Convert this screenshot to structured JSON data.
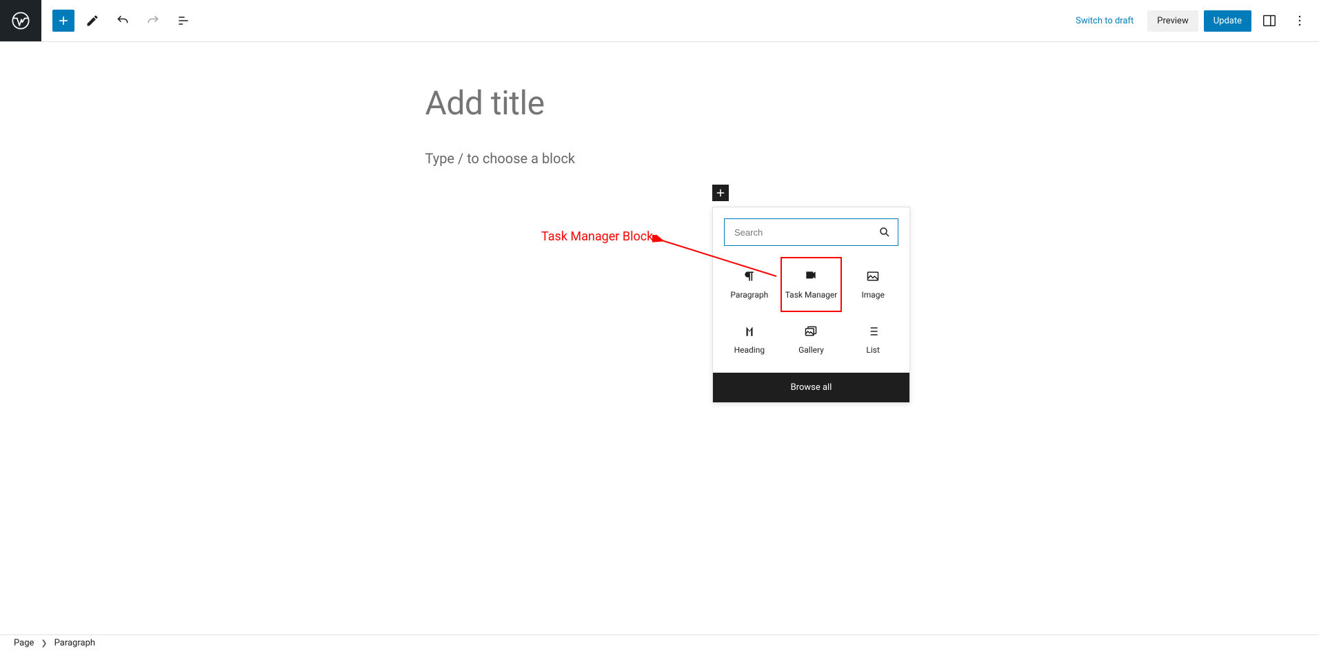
{
  "toolbar": {
    "switch_to_draft": "Switch to draft",
    "preview": "Preview",
    "update": "Update"
  },
  "editor": {
    "title_placeholder": "Add title",
    "body_placeholder": "Type / to choose a block"
  },
  "inserter": {
    "search_placeholder": "Search",
    "blocks": {
      "paragraph": "Paragraph",
      "task_manager": "Task Manager",
      "image": "Image",
      "heading": "Heading",
      "gallery": "Gallery",
      "list": "List"
    },
    "browse_all": "Browse all"
  },
  "annotation": {
    "label": "Task Manager Block"
  },
  "breadcrumb": {
    "root": "Page",
    "current": "Paragraph"
  }
}
